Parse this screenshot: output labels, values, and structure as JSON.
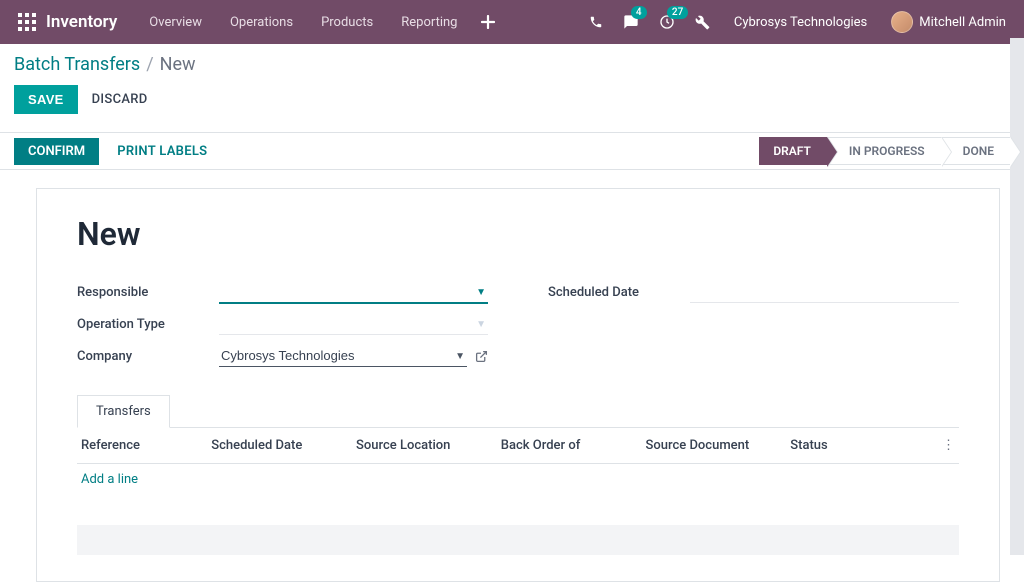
{
  "topbar": {
    "brand": "Inventory",
    "nav": [
      "Overview",
      "Operations",
      "Products",
      "Reporting"
    ],
    "messages_badge": "4",
    "activities_badge": "27",
    "company": "Cybrosys Technologies",
    "user": "Mitchell Admin"
  },
  "breadcrumb": {
    "parent": "Batch Transfers",
    "current": "New"
  },
  "buttons": {
    "save": "SAVE",
    "discard": "DISCARD",
    "confirm": "CONFIRM",
    "print_labels": "PRINT LABELS"
  },
  "stages": {
    "draft": "DRAFT",
    "in_progress": "IN PROGRESS",
    "done": "DONE"
  },
  "form": {
    "title": "New",
    "labels": {
      "responsible": "Responsible",
      "operation_type": "Operation Type",
      "company": "Company",
      "scheduled_date": "Scheduled Date"
    },
    "values": {
      "responsible": "",
      "operation_type": "",
      "company": "Cybrosys Technologies",
      "scheduled_date": ""
    }
  },
  "tabs": {
    "transfers": "Transfers"
  },
  "table": {
    "headers": {
      "reference": "Reference",
      "scheduled_date": "Scheduled Date",
      "source_location": "Source Location",
      "back_order_of": "Back Order of",
      "source_document": "Source Document",
      "status": "Status"
    },
    "add_line": "Add a line"
  }
}
